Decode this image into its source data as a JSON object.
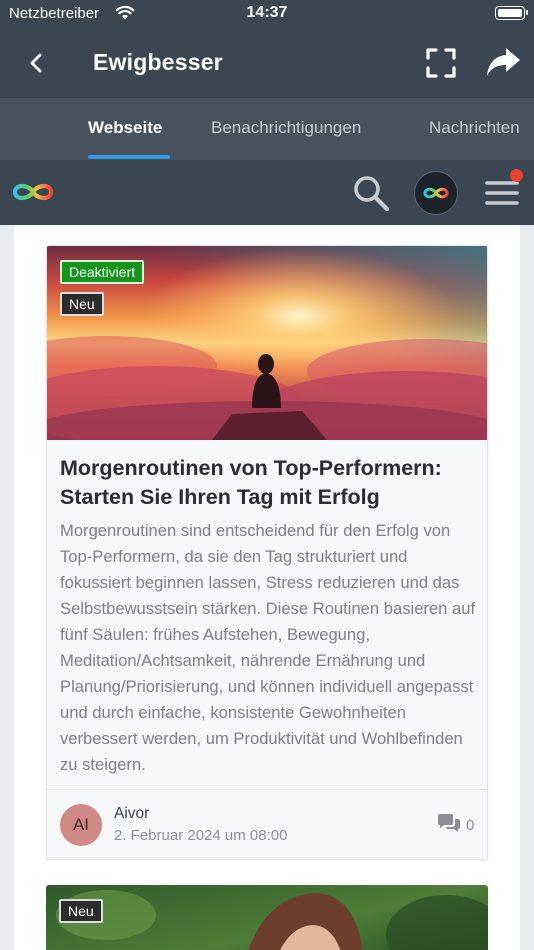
{
  "status_bar": {
    "carrier": "Netzbetreiber",
    "time": "14:37",
    "wifi_icon": "wifi-icon",
    "battery_icon": "battery-icon"
  },
  "nav": {
    "title": "Ewigbesser",
    "back_icon": "chevron-left-icon",
    "fullscreen_icon": "fullscreen-icon",
    "share_icon": "share-arrow-icon"
  },
  "tabs": [
    {
      "label": "Webseite",
      "active": true
    },
    {
      "label": "Benachrichtigungen",
      "active": false
    },
    {
      "label": "Nachrichten",
      "active": false
    }
  ],
  "site_header": {
    "logo_icon": "infinity-logo-icon",
    "search_icon": "search-icon",
    "avatar_icon": "infinity-avatar-icon",
    "menu_icon": "hamburger-menu-icon",
    "notification_color": "#e8432c"
  },
  "posts": [
    {
      "badges": [
        "Deaktiviert",
        "Neu"
      ],
      "title": "Morgenroutinen von Top-Performern: Starten Sie Ihren Tag mit Erfolg",
      "excerpt": "Morgenroutinen sind entscheidend für den Erfolg von Top-Performern, da sie den Tag strukturiert und fokussiert beginnen lassen, Stress reduzieren und das Selbstbewusstsein stärken. Diese Routinen basieren auf fünf Säulen: frühes Aufstehen, Bewegung, Meditation/Achtsamkeit, nährende Ernährung und Planung/Priorisierung, und können individuell angepasst und durch einfache, konsistente Gewohnheiten verbessert werden, um Produktivität und Wohlbefinden zu steigern.",
      "author_initials": "AI",
      "author": "Aivor",
      "date": "2. Februar 2024 um 08:00",
      "comments": "0"
    },
    {
      "badges": [
        "Neu"
      ]
    }
  ],
  "colors": {
    "header_bg": "#3b4653",
    "tab_bg": "#48525e",
    "tab_indicator": "#2f9be8",
    "badge_green": "#15931c"
  }
}
